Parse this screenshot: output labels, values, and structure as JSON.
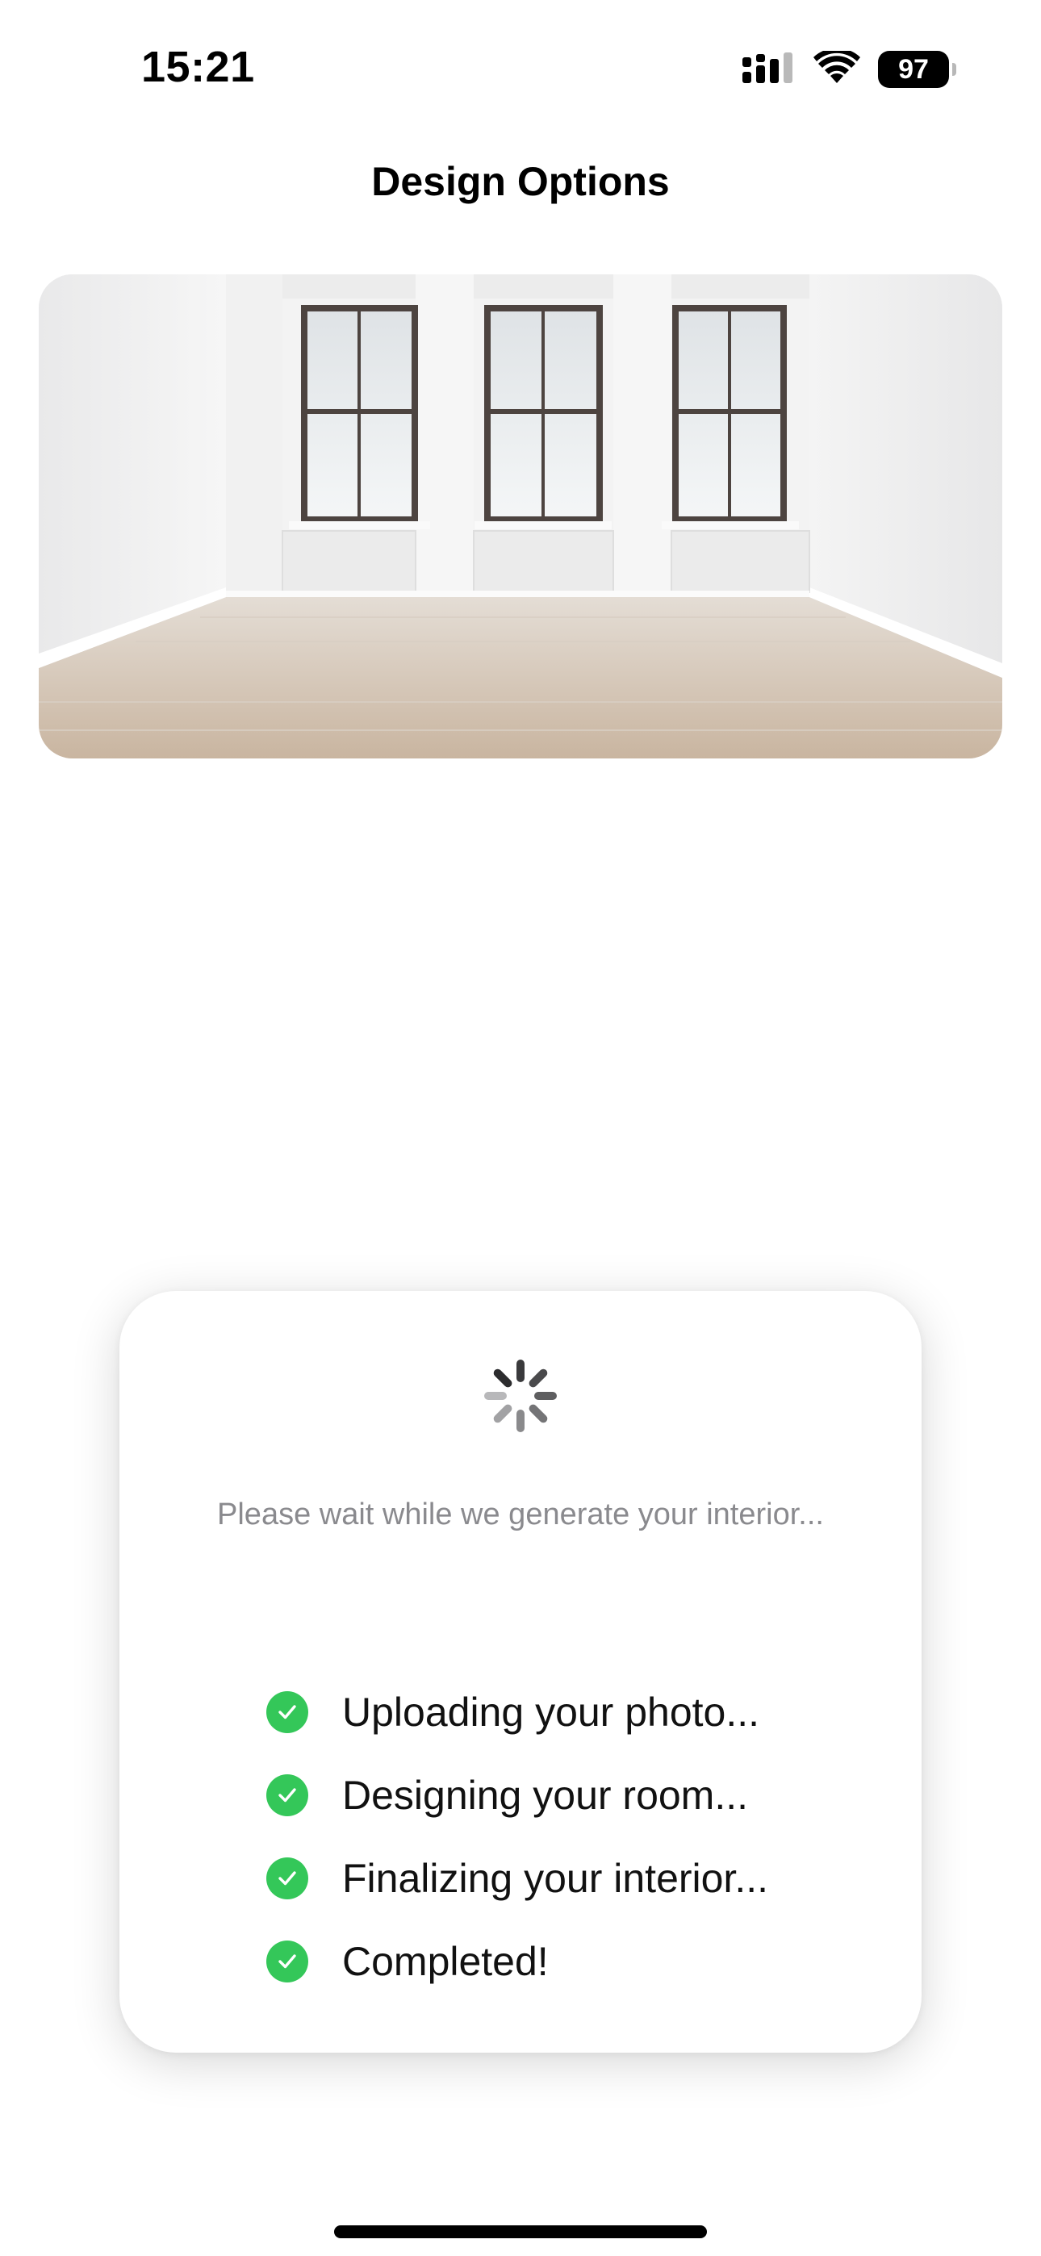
{
  "status_bar": {
    "time": "15:21",
    "battery_level": "97",
    "icons": [
      "cellular-signal-icon",
      "wifi-icon",
      "battery-icon"
    ]
  },
  "header": {
    "title": "Design Options"
  },
  "room_image": {
    "subject": "empty-room-photo"
  },
  "loading_card": {
    "spinner": "activity-spinner-icon",
    "message": "Please wait while we generate your interior...",
    "steps": [
      {
        "label": "Uploading your photo...",
        "status": "done"
      },
      {
        "label": "Designing your room...",
        "status": "done"
      },
      {
        "label": "Finalizing your interior...",
        "status": "done"
      },
      {
        "label": "Completed!",
        "status": "done"
      }
    ]
  },
  "colors": {
    "check_green": "#34c759",
    "message_gray": "#8a8a8e"
  }
}
